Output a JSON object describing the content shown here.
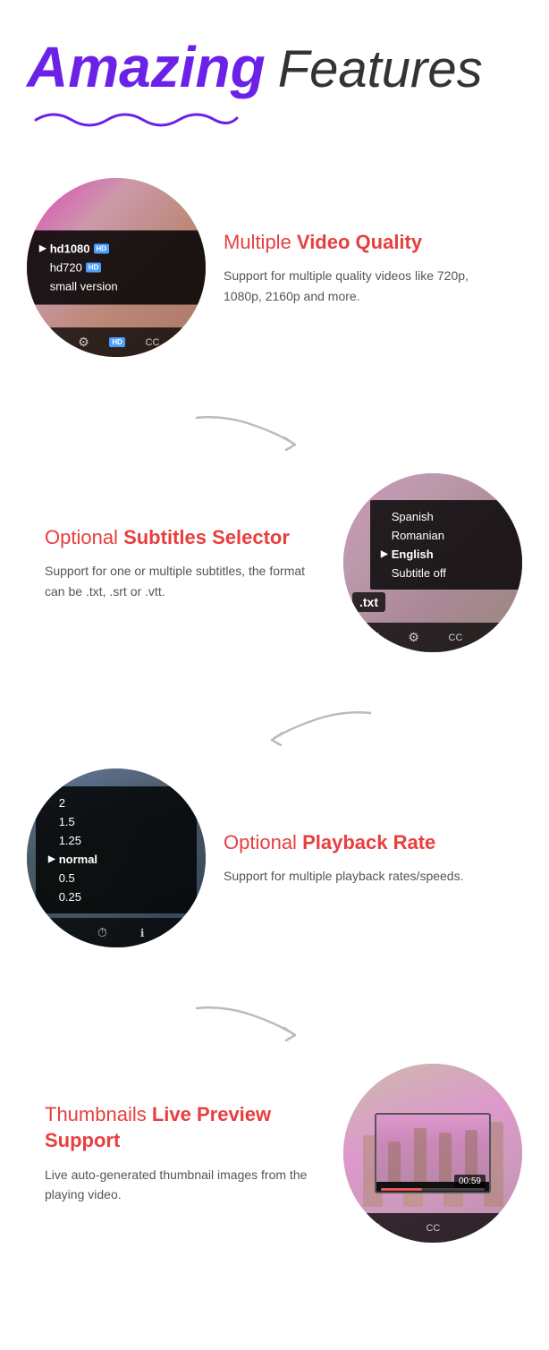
{
  "header": {
    "title_amazing": "Amazing",
    "title_features": "Features"
  },
  "features": [
    {
      "id": "video-quality",
      "layout": "left-image",
      "label_prefix": "Multiple",
      "label_bold": "Video Quality",
      "description": "Support for multiple quality videos like 720p, 1080p, 2160p and more.",
      "quality_options": [
        {
          "label": "hd1080",
          "badge": "HD",
          "active": true
        },
        {
          "label": "hd720",
          "badge": "HD",
          "active": false
        },
        {
          "label": "small version",
          "badge": "",
          "active": false
        }
      ]
    },
    {
      "id": "subtitles",
      "layout": "right-image",
      "label_prefix": "Optional",
      "label_bold": "Subtitles Selector",
      "description": "Support for one or multiple subtitles, the format can be .txt, .srt or .vtt.",
      "subtitle_options": [
        {
          "label": "Spanish",
          "active": false
        },
        {
          "label": "Romanian",
          "active": false
        },
        {
          "label": "English",
          "active": true
        },
        {
          "label": "Subtitle off",
          "active": false
        }
      ]
    },
    {
      "id": "playback-rate",
      "layout": "left-image",
      "label_prefix": "Optional",
      "label_bold": "Playback Rate",
      "description": "Support for multiple playback rates/speeds.",
      "playback_options": [
        {
          "label": "2",
          "active": false
        },
        {
          "label": "1.5",
          "active": false
        },
        {
          "label": "1.25",
          "active": false
        },
        {
          "label": "normal",
          "active": true
        },
        {
          "label": "0.5",
          "active": false
        },
        {
          "label": "0.25",
          "active": false
        }
      ]
    },
    {
      "id": "thumbnails",
      "layout": "right-image",
      "label_line1": "Thumbnails",
      "label_bold": "Live Preview Support",
      "description": "Live auto-generated thumbnail images from the playing video.",
      "timestamp": "00:59"
    }
  ]
}
